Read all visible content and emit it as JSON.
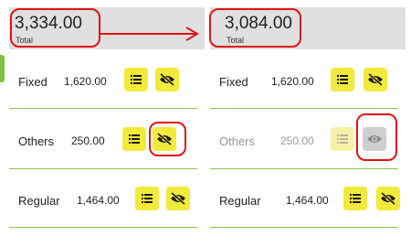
{
  "before": {
    "total": {
      "amount": "3,334.00",
      "label": "Total"
    },
    "rows": [
      {
        "name": "Fixed",
        "amount": "1,620.00"
      },
      {
        "name": "Others",
        "amount": "250.00"
      },
      {
        "name": "Regular",
        "amount": "1,464.00"
      }
    ]
  },
  "after": {
    "total": {
      "amount": "3,084.00",
      "label": "Total"
    },
    "rows": [
      {
        "name": "Fixed",
        "amount": "1,620.00"
      },
      {
        "name": "Others",
        "amount": "250.00",
        "hidden": true
      },
      {
        "name": "Regular",
        "amount": "1,464.00"
      }
    ]
  },
  "colors": {
    "accent_button": "#f2ea3b",
    "highlight": "#e01414",
    "separator": "#8bc34a",
    "total_bg": "#e0e0e0"
  },
  "icons": {
    "list": "list-icon",
    "visibility_off": "eye-off-icon",
    "visibility_on": "eye-icon"
  }
}
